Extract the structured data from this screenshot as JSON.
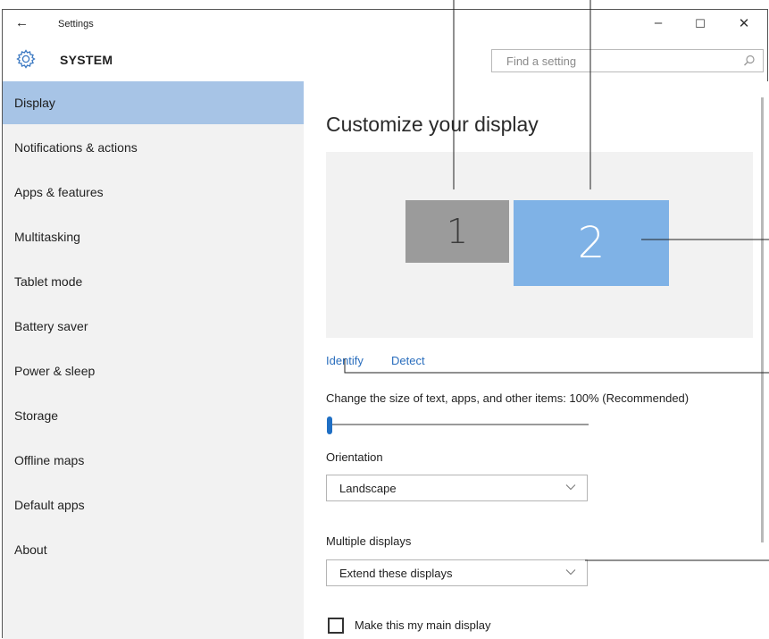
{
  "window": {
    "title": "Settings",
    "back_icon": "back-arrow-icon",
    "minimize_glyph": "–",
    "maximize_glyph": "☐",
    "close_glyph": "✕"
  },
  "header": {
    "section": "SYSTEM",
    "search_placeholder": "Find a setting"
  },
  "sidebar": {
    "items": [
      {
        "label": "Display",
        "active": true
      },
      {
        "label": "Notifications & actions",
        "active": false
      },
      {
        "label": "Apps & features",
        "active": false
      },
      {
        "label": "Multitasking",
        "active": false
      },
      {
        "label": "Tablet mode",
        "active": false
      },
      {
        "label": "Battery saver",
        "active": false
      },
      {
        "label": "Power & sleep",
        "active": false
      },
      {
        "label": "Storage",
        "active": false
      },
      {
        "label": "Offline maps",
        "active": false
      },
      {
        "label": "Default apps",
        "active": false
      },
      {
        "label": "About",
        "active": false
      }
    ]
  },
  "main": {
    "title": "Customize your display",
    "monitors": [
      {
        "label": "1",
        "selected": false
      },
      {
        "label": "2",
        "selected": true
      }
    ],
    "identify_link": "Identify",
    "detect_link": "Detect",
    "scale_label": "Change the size of text, apps, and other items: 100% (Recommended)",
    "scale_slider_value": 0,
    "orientation_label": "Orientation",
    "orientation_value": "Landscape",
    "multiple_displays_label": "Multiple displays",
    "multiple_displays_value": "Extend these displays",
    "main_display_checkbox_label": "Make this my main display",
    "main_display_checked": false
  },
  "colors": {
    "accent": "#1f6fc4",
    "active_nav": "#a7c4e6",
    "selected_monitor": "#7fb2e6",
    "monitor": "#9b9b9b",
    "link": "#2a6ebd"
  }
}
